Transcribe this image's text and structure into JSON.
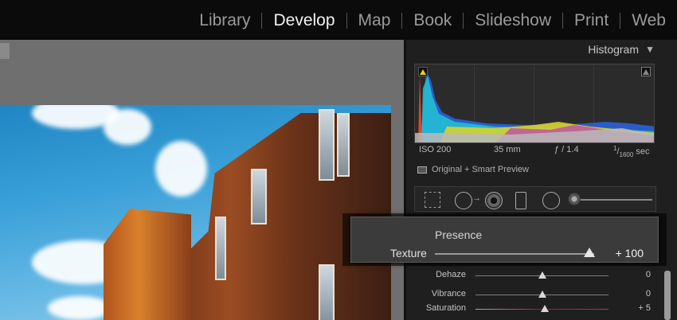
{
  "modules": {
    "items": [
      "Library",
      "Develop",
      "Map",
      "Book",
      "Slideshow",
      "Print",
      "Web"
    ],
    "active": "Develop"
  },
  "histogram": {
    "title": "Histogram",
    "collapse_icon": "triangle-down-icon",
    "iso": "ISO 200",
    "focal": "35 mm",
    "aperture": "ƒ / 1.4",
    "shutter_num": "1",
    "shutter_den": "1600",
    "shutter_unit": "sec",
    "preview_label": "Original + Smart Preview"
  },
  "tools": [
    "crop-overlay-icon",
    "spot-removal-icon",
    "red-eye-icon",
    "graduated-filter-icon",
    "radial-filter-icon",
    "adjustment-brush-icon"
  ],
  "presence": {
    "title": "Presence",
    "texture_label": "Texture",
    "texture_value": "+ 100",
    "texture_fraction": 1.0
  },
  "sliders": [
    {
      "label": "Dehaze",
      "value": "0",
      "fraction": 0.5
    },
    {
      "label": "Vibrance",
      "value": "0",
      "fraction": 0.5
    },
    {
      "label": "Saturation",
      "value": "+ 5",
      "fraction": 0.52
    }
  ],
  "colors": {
    "background": "#000000",
    "panel": "#1f1f1f",
    "active_module": "#f2f2f2",
    "inactive_module": "#9a9a9a"
  }
}
